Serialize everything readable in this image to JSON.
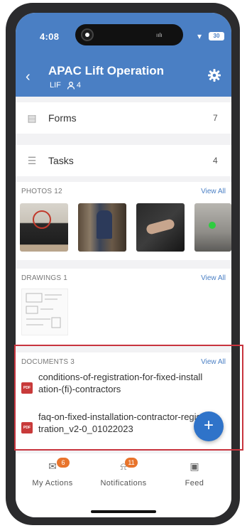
{
  "status": {
    "time": "4:08",
    "battery": "30"
  },
  "header": {
    "title": "APAC Lift Operation",
    "code": "LIF",
    "members": "4"
  },
  "rows": [
    {
      "label": "Forms",
      "count": "7"
    },
    {
      "label": "Tasks",
      "count": "4"
    }
  ],
  "photos": {
    "title": "PHOTOS",
    "count": "12",
    "view_all": "View All"
  },
  "drawings": {
    "title": "DRAWINGS",
    "count": "1",
    "view_all": "View All"
  },
  "documents": {
    "title": "DOCUMENTS",
    "count": "3",
    "view_all": "View All",
    "items": [
      {
        "name": "conditions-of-registration-for-fixed-installation-(fi)-contractors",
        "type": "PDF"
      },
      {
        "name": "faq-on-fixed-installation-contractor-registration_v2-0_01022023",
        "type": "PDF"
      }
    ]
  },
  "fab": {
    "label": "+"
  },
  "nav": [
    {
      "label": "My Actions",
      "badge": "6"
    },
    {
      "label": "Notifications",
      "badge": "11"
    },
    {
      "label": "Feed"
    }
  ],
  "colors": {
    "header": "#4a7fc4",
    "accent": "#2f73c9",
    "badge": "#e8742c",
    "highlight": "#c8343e"
  }
}
